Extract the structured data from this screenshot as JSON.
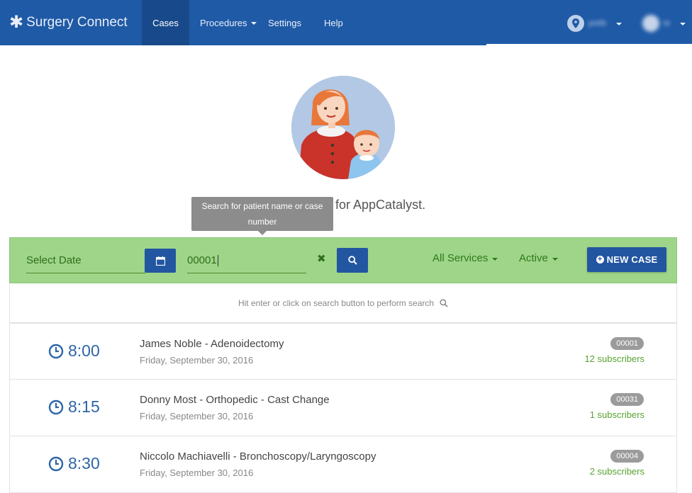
{
  "app": {
    "title": "Surgery Connect"
  },
  "nav": {
    "items": [
      {
        "label": "Cases",
        "active": true
      },
      {
        "label": "Procedures",
        "dropdown": true
      },
      {
        "label": "Settings"
      },
      {
        "label": "Help"
      }
    ],
    "location_label": "prefe",
    "user_label": "te"
  },
  "welcome": {
    "text": "ses for AppCatalyst."
  },
  "tooltip": {
    "text": "Search for patient name or case number"
  },
  "search": {
    "date_placeholder": "Select Date",
    "value": "00001",
    "filter_services": "All Services",
    "filter_status": "Active",
    "new_case_label": "NEW CASE",
    "hint": "Hit enter or click on search button to perform search"
  },
  "colors": {
    "navbar": "#1f5aa6",
    "searchbar": "#9ed589",
    "primary_button": "#2356a1",
    "subscribers": "#5aa332"
  },
  "cases": [
    {
      "time": "8:00",
      "title": "James Noble - Adenoidectomy",
      "date": "Friday, September 30, 2016",
      "number": "00001",
      "subscribers": "12 subscribers"
    },
    {
      "time": "8:15",
      "title": "Donny Most - Orthopedic - Cast Change",
      "date": "Friday, September 30, 2016",
      "number": "00031",
      "subscribers": "1 subscribers"
    },
    {
      "time": "8:30",
      "title": "Niccolo Machiavelli - Bronchoscopy/Laryngoscopy",
      "date": "Friday, September 30, 2016",
      "number": "00004",
      "subscribers": "2 subscribers"
    }
  ]
}
